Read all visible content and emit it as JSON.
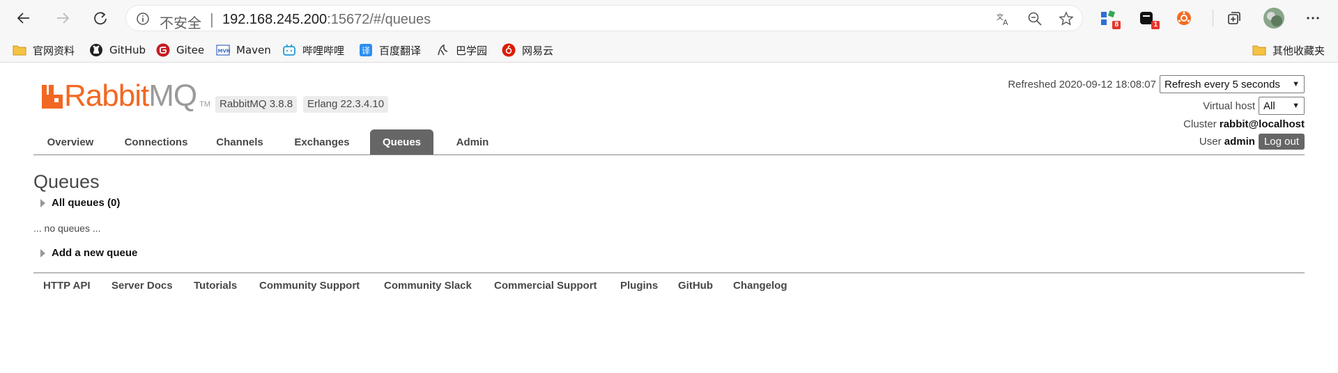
{
  "browser": {
    "address": {
      "insecure_label": "不安全",
      "host": "192.168.245.200",
      "rest": ":15672/#/queues"
    },
    "extension_badges": [
      "8",
      "1"
    ],
    "bookmarks": [
      {
        "label": "官网资料",
        "icon": "folder-icon"
      },
      {
        "label": "GitHub",
        "icon": "github-icon"
      },
      {
        "label": "Gitee",
        "icon": "gitee-icon"
      },
      {
        "label": "Maven",
        "icon": "maven-icon"
      },
      {
        "label": "哔哩哔哩",
        "icon": "bilibili-icon"
      },
      {
        "label": "百度翻译",
        "icon": "baidu-translate-icon"
      },
      {
        "label": "巴学园",
        "icon": "bxy-icon"
      },
      {
        "label": "网易云",
        "icon": "netease-music-icon"
      }
    ],
    "other_bookmarks": "其他收藏夹"
  },
  "rabbitmq": {
    "logo": {
      "part1": "Rabbit",
      "part2": "MQ",
      "tm": "TM"
    },
    "version": "RabbitMQ 3.8.8",
    "erlang": "Erlang 22.3.4.10",
    "refreshed_label": "Refreshed 2020-09-12 18:08:07",
    "refresh_select": "Refresh every 5 seconds",
    "vhost_label": "Virtual host",
    "vhost_select": "All",
    "cluster_label": "Cluster",
    "cluster_name": "rabbit@localhost",
    "user_label": "User",
    "user_name": "admin",
    "logout": "Log out",
    "tabs": [
      "Overview",
      "Connections",
      "Channels",
      "Exchanges",
      "Queues",
      "Admin"
    ],
    "active_tab": "Queues",
    "page_title": "Queues",
    "all_queues": "All queues (0)",
    "no_queues": "... no queues ...",
    "add_queue": "Add a new queue",
    "footer_links": [
      "HTTP API",
      "Server Docs",
      "Tutorials",
      "Community Support",
      "Community Slack",
      "Commercial Support",
      "Plugins",
      "GitHub",
      "Changelog"
    ]
  },
  "colors": {
    "brand_orange": "#f26822",
    "active_tab_bg": "#666666",
    "text": "#484848"
  }
}
